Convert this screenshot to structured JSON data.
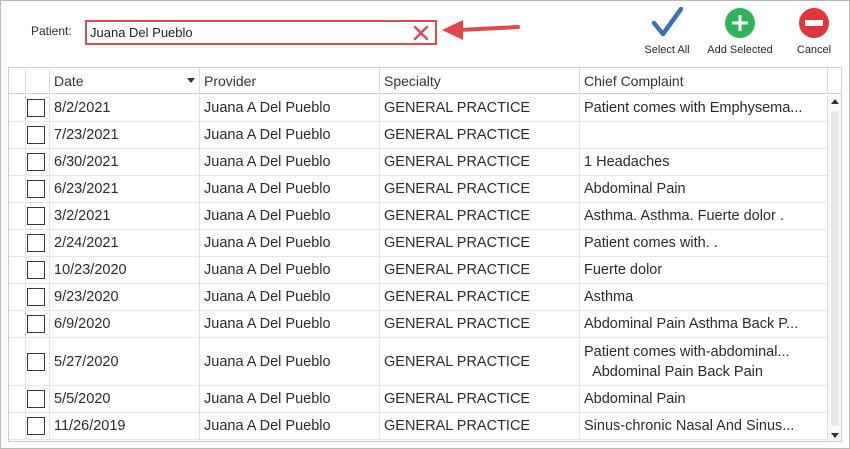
{
  "toolbar": {
    "patient_label": "Patient:",
    "patient_value": "Juana Del Pueblo",
    "select_all_label": "Select All",
    "add_selected_label": "Add Selected",
    "cancel_label": "Cancel"
  },
  "colors": {
    "highlight_red": "#e0484b",
    "checkmark_blue": "#3f6fb5",
    "add_green": "#2fb457",
    "cancel_red": "#e2353b"
  },
  "icons": {
    "clear": "close-x-icon",
    "select_all": "checkmark-icon",
    "add_selected": "plus-circle-icon",
    "cancel": "minus-circle-icon"
  },
  "grid": {
    "columns": {
      "date": "Date",
      "provider": "Provider",
      "specialty": "Specialty",
      "complaint": "Chief Complaint"
    },
    "sort_column": "Date",
    "rows": [
      {
        "date": "8/2/2021",
        "provider": "Juana A Del Pueblo",
        "specialty": "GENERAL PRACTICE",
        "complaint": "Patient comes with  Emphysema..."
      },
      {
        "date": "7/23/2021",
        "provider": "Juana A Del Pueblo",
        "specialty": "GENERAL PRACTICE",
        "complaint": ""
      },
      {
        "date": "6/30/2021",
        "provider": "Juana A Del Pueblo",
        "specialty": "GENERAL PRACTICE",
        "complaint": "1  Headaches"
      },
      {
        "date": "6/23/2021",
        "provider": "Juana A Del Pueblo",
        "specialty": "GENERAL PRACTICE",
        "complaint": "Abdominal Pain"
      },
      {
        "date": "3/2/2021",
        "provider": "Juana A Del Pueblo",
        "specialty": "GENERAL PRACTICE",
        "complaint": "Asthma.   Asthma.   Fuerte dolor ."
      },
      {
        "date": "2/24/2021",
        "provider": "Juana A Del Pueblo",
        "specialty": "GENERAL PRACTICE",
        "complaint": "Patient comes with. ."
      },
      {
        "date": "10/23/2020",
        "provider": "Juana A Del Pueblo",
        "specialty": "GENERAL PRACTICE",
        "complaint": "Fuerte dolor"
      },
      {
        "date": "9/23/2020",
        "provider": "Juana A Del Pueblo",
        "specialty": "GENERAL PRACTICE",
        "complaint": "Asthma"
      },
      {
        "date": "6/9/2020",
        "provider": "Juana A Del Pueblo",
        "specialty": "GENERAL PRACTICE",
        "complaint": "Abdominal Pain  Asthma  Back P..."
      },
      {
        "date": "5/27/2020",
        "provider": "Juana A Del Pueblo",
        "specialty": "GENERAL PRACTICE",
        "complaint": "Patient comes with-abdominal...",
        "complaint_line2": "Abdominal Pain  Back Pain"
      },
      {
        "date": "5/5/2020",
        "provider": "Juana A Del Pueblo",
        "specialty": "GENERAL PRACTICE",
        "complaint": "Abdominal Pain"
      },
      {
        "date": "11/26/2019",
        "provider": "Juana A Del Pueblo",
        "specialty": "GENERAL PRACTICE",
        "complaint": "Sinus-chronic  Nasal And Sinus..."
      }
    ]
  }
}
